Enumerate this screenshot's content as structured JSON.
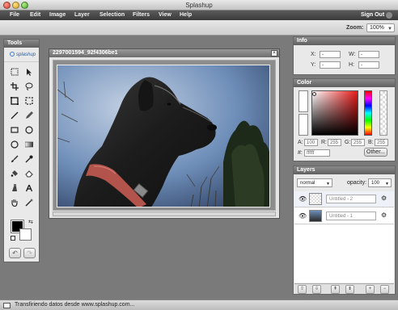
{
  "window": {
    "title": "Splashup"
  },
  "menu": {
    "items": [
      "File",
      "Edit",
      "Image",
      "Layer",
      "Selection",
      "Filters",
      "View",
      "Help"
    ],
    "signout": "Sign Out"
  },
  "zoom": {
    "label": "Zoom:",
    "value": "100%"
  },
  "tools": {
    "title": "Tools",
    "logo": "splashup",
    "icons": [
      "marquee-rect-icon",
      "pointer-icon",
      "crop-icon",
      "lasso-icon",
      "marquee-square-icon",
      "marquee-dotted-icon",
      "line-icon",
      "pencil-icon",
      "rect-shape-icon",
      "ellipse-shape-icon",
      "circle-icon",
      "gradient-icon",
      "brush-icon",
      "eyedropper-icon",
      "fill-bucket-icon",
      "eraser-icon",
      "clone-icon",
      "text-icon",
      "hand-icon",
      "magic-wand-icon"
    ],
    "colors": {
      "foreground": "#000000",
      "background": "#ffffff"
    }
  },
  "image_window": {
    "title": "2297001594_92f4306be1"
  },
  "info": {
    "title": "Info",
    "x_label": "X:",
    "x_value": "-",
    "y_label": "Y:",
    "y_value": "-",
    "w_label": "W:",
    "w_value": "-",
    "h_label": "H:",
    "h_value": "-"
  },
  "color": {
    "title": "Color",
    "a_label": "A:",
    "a_value": "100",
    "r_label": "R:",
    "r_value": "255",
    "g_label": "G:",
    "g_value": "255",
    "b_label": "B:",
    "b_value": "255",
    "hex_label": "#:",
    "hex_value": "ffffff",
    "other_label": "Other..."
  },
  "layers": {
    "title": "Layers",
    "blend": "normal",
    "opacity_label": "opacity:",
    "opacity": "100",
    "items": [
      {
        "name": "Untitled - 2"
      },
      {
        "name": "Untitled - 1"
      }
    ]
  },
  "status": {
    "text": "Transfiriendo datos desde www.splashup.com..."
  }
}
